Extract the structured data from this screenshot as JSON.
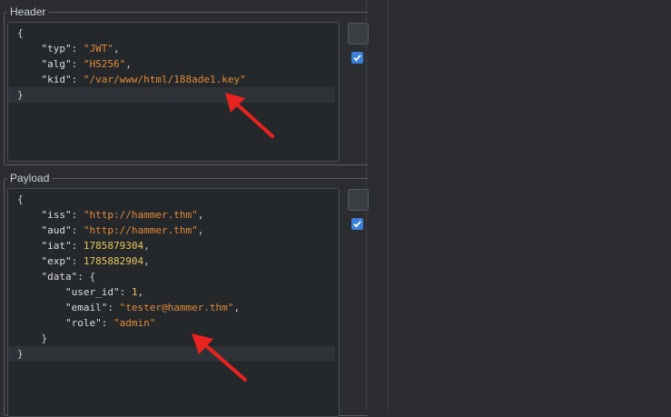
{
  "header": {
    "label": "Header",
    "lines": [
      "{",
      "    \"typ\": \"JWT\",",
      "    \"alg\": \"HS256\",",
      "    \"kid\": \"/var/www/html/188ade1.key\"",
      "}"
    ],
    "checkbox_checked": true
  },
  "payload": {
    "label": "Payload",
    "lines": [
      "{",
      "    \"iss\": \"http://hammer.thm\",",
      "    \"aud\": \"http://hammer.thm\",",
      "    \"iat\": 1785879304,",
      "    \"exp\": 1785882904,",
      "    \"data\": {",
      "        \"user_id\": 1,",
      "        \"email\": \"tester@hammer.thm\",",
      "        \"role\": \"admin\"",
      "    }",
      "}"
    ],
    "checkbox_checked": true
  },
  "colors": {
    "key": "#dcdcdc",
    "string": "#e08a3a",
    "number": "#e8c55c",
    "arrow": "#e8231f",
    "checkbox": "#3c7fd6"
  },
  "icons": [
    "arrow-annotation",
    "checkbox-check-icon"
  ]
}
